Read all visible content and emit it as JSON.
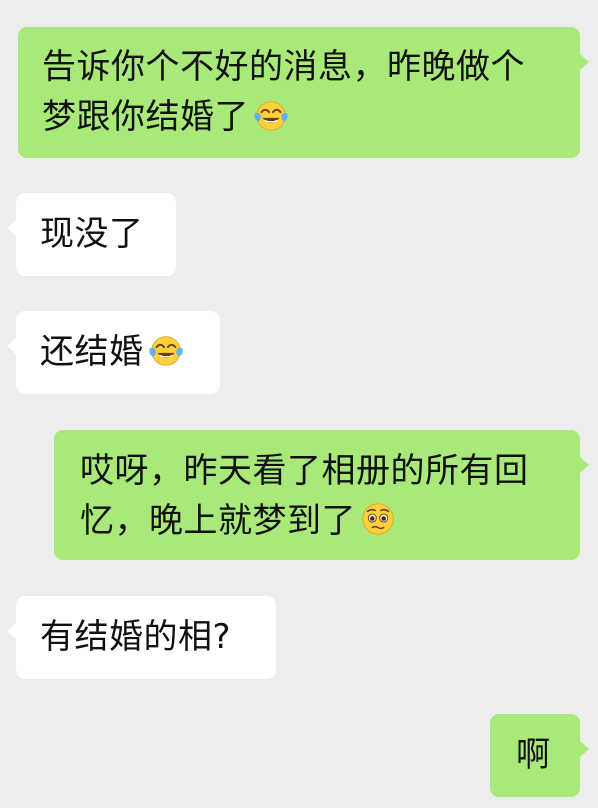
{
  "messages": [
    {
      "id": "m1",
      "side": "sent",
      "lines": [
        "告诉你个不好的消息，昨晚做个",
        "梦跟你结婚了"
      ],
      "emoji": "tears-of-joy-icon"
    },
    {
      "id": "m2",
      "side": "received",
      "lines": [
        "现没了"
      ],
      "emoji": null
    },
    {
      "id": "m3",
      "side": "received",
      "lines": [
        "还结婚"
      ],
      "emoji": "tears-of-joy-icon"
    },
    {
      "id": "m4",
      "side": "sent",
      "lines": [
        "哎呀，昨天看了相册的所有回",
        "忆，晚上就梦到了"
      ],
      "emoji": "pleading-face-icon"
    },
    {
      "id": "m5",
      "side": "received",
      "lines": [
        "有结婚的相?"
      ],
      "emoji": null
    },
    {
      "id": "m6",
      "side": "sent",
      "lines": [
        "啊"
      ],
      "emoji": null
    }
  ],
  "colors": {
    "background": "#ededed",
    "sent_bubble": "#a9e97a",
    "received_bubble": "#ffffff",
    "text": "#111111"
  }
}
